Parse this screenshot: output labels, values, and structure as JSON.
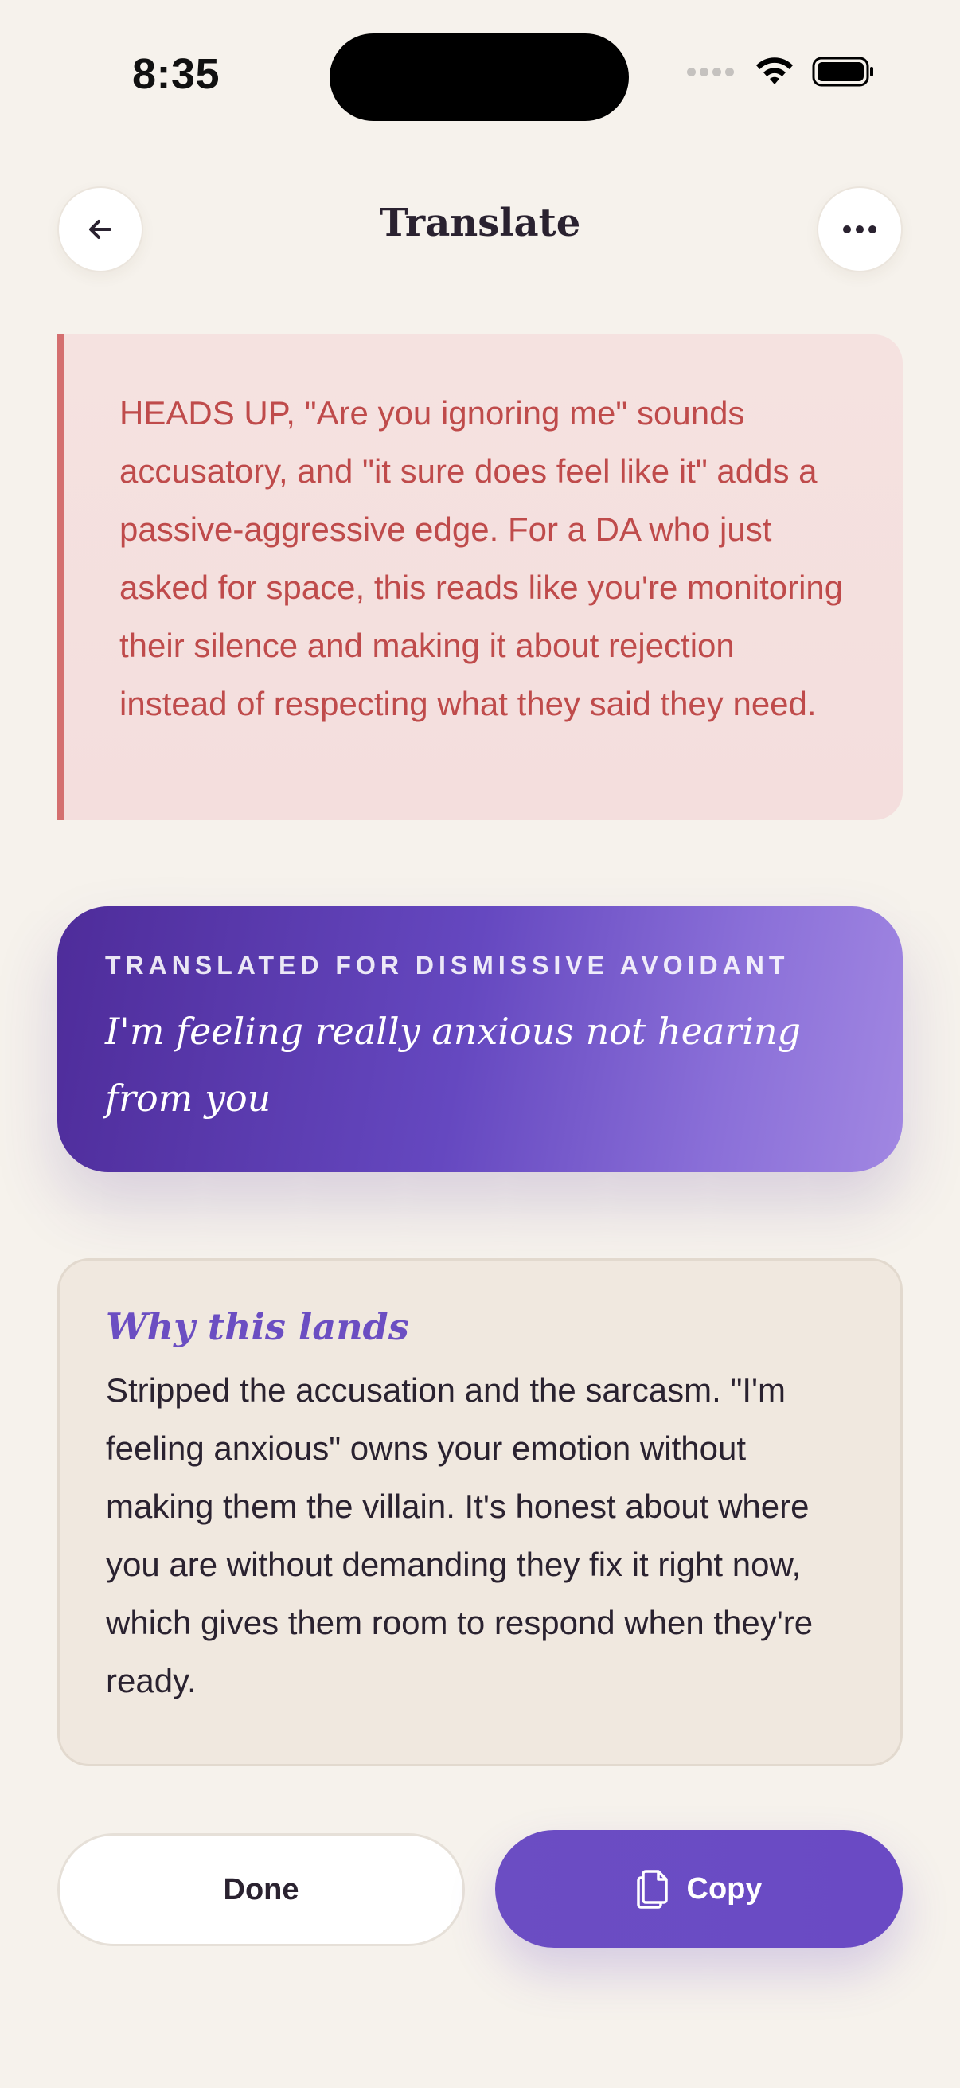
{
  "status_bar": {
    "time": "8:35",
    "icons": [
      "signal-icon",
      "wifi-icon",
      "battery-icon"
    ]
  },
  "header": {
    "title": "Translate",
    "back_icon": "arrow-left-icon",
    "more_icon": "ellipsis-icon"
  },
  "warning": {
    "text": "HEADS UP, \"Are you ignoring me\" sounds accusatory, and \"it sure does feel like it\" adds a passive-aggressive edge. For a DA who just asked for space, this reads like you're monitoring their silence and making it about rejection instead of respecting what they said they need.",
    "color": "#bf4b4b",
    "accent": "#d46f6f"
  },
  "translation": {
    "label": "TRANSLATED FOR DISMISSIVE AVOIDANT",
    "text": "I'm feeling really anxious not hearing from you"
  },
  "explanation": {
    "title": "Why this lands",
    "text": "Stripped the accusation and the sarcasm. \"I'm feeling anxious\" owns your emotion without making them the villain. It's honest about where you are without demanding they fix it right now, which gives them room to respond when they're ready."
  },
  "actions": {
    "done_label": "Done",
    "copy_label": "Copy",
    "copy_icon": "copy-icon"
  },
  "colors": {
    "background": "#f6f2ec",
    "accent": "#6b4ec2"
  }
}
